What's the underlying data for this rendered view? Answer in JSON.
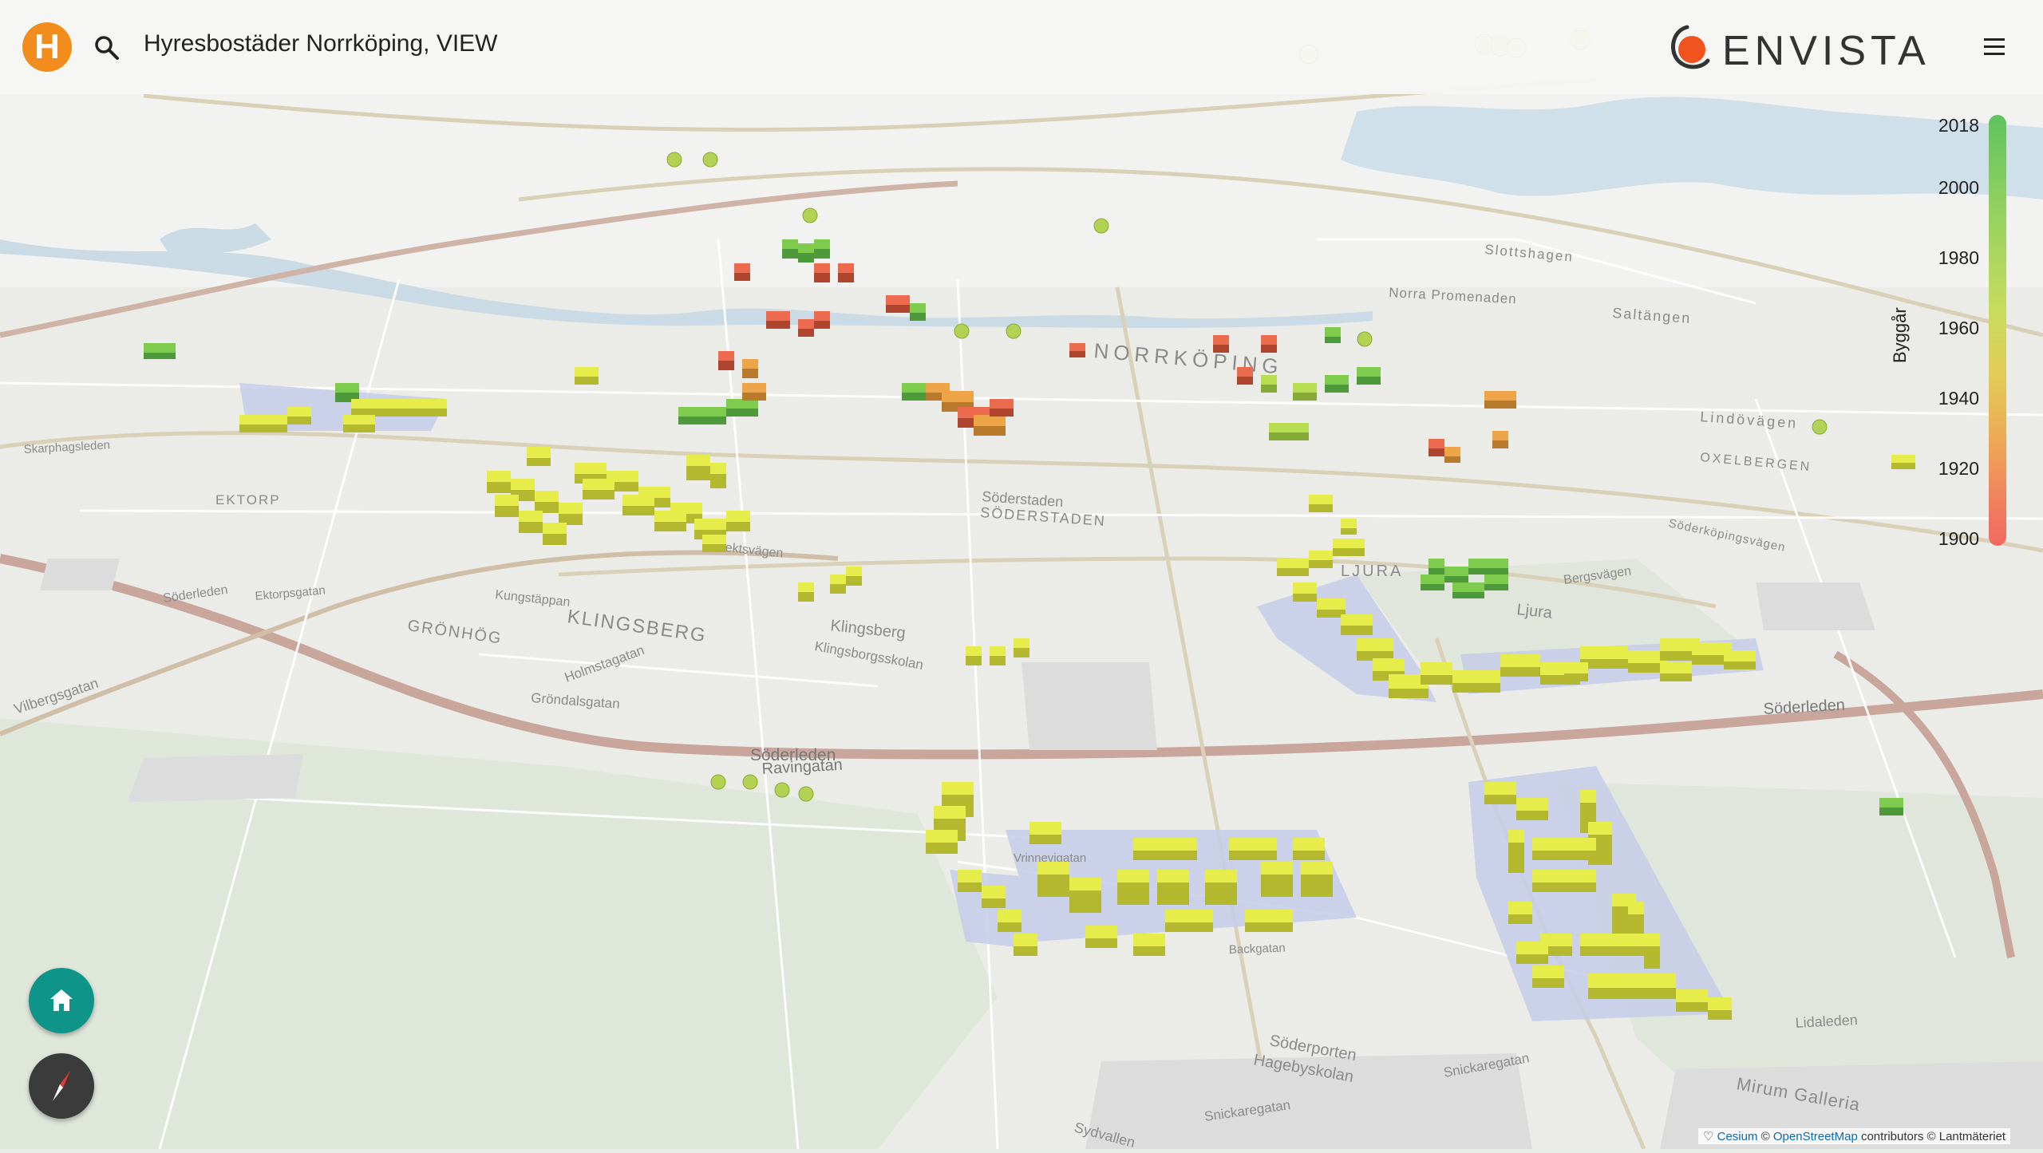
{
  "header": {
    "logo_letter": "H",
    "title": "Hyresbostäder Norrköping, VIEW",
    "brand": "ENVISTA",
    "icons": {
      "search": "search-icon",
      "menu": "menu-icon"
    }
  },
  "legend": {
    "title": "Byggår",
    "ticks": [
      "2018",
      "2000",
      "1980",
      "1960",
      "1940",
      "1920",
      "1900"
    ],
    "colors": {
      "old": "#f16a62",
      "mid": "#e2cd57",
      "new": "#5fc35e"
    }
  },
  "map_labels": {
    "norrkoping": "NORRKÖPING",
    "soderstaden1": "Söderstaden",
    "soderstaden2": "SÖDERSTADEN",
    "klingsberg1": "KLINGSBERG",
    "klingsberg2": "Klingsberg",
    "klingsborgsskolan": "Klingsborgsskolan",
    "gronhog": "GRÖNHÖG",
    "kungstappan": "Kungstäppan",
    "holmstagatan": "Holmstagatan",
    "grondalsgatan": "Gröndalsgatan",
    "soderleden1": "Söderleden",
    "soderleden2": "Söderleden",
    "soderleden3": "Söderleden",
    "ravingatan": "Ravingatan",
    "albrektsvagen": "Albrektsvägen",
    "ljura1": "LJURA",
    "ljura2": "Ljura",
    "lidaleden": "Lidaleden",
    "soderporten": "Söderporten",
    "hageby": "Hagebyskolan",
    "snickaregatan1": "Snickaregatan",
    "snickaregatan2": "Snickaregatan",
    "mirum": "Mirum Galleria",
    "sydvallen": "Sydvallen",
    "backgatan": "Backgatan",
    "vrinnevigatan": "Vrinnevigatan",
    "norra_promenaden": "Norra Promenaden",
    "saltangen": "Saltängen",
    "slottshagen": "Slottshagen",
    "oxelbergen": "OXELBERGEN",
    "lindovagen": "Lindövägen",
    "ektorp": "EKTORP",
    "ektorpsgatan": "Ektorpsgatan",
    "vilbergsgatan": "Vilbergsgatan",
    "soderkopingsvagen": "Söderköpingsvägen",
    "skarphagsleden": "Skarphagsleden",
    "bergsvagen": "Bergsvägen"
  },
  "controls": {
    "home_icon": "home-icon",
    "compass_icon": "compass-icon"
  },
  "credits": {
    "heart": "♡",
    "cesium": "Cesium",
    "copy1": "©",
    "osm": "OpenStreetMap",
    "contributors": "contributors © Lantmäteriet"
  }
}
